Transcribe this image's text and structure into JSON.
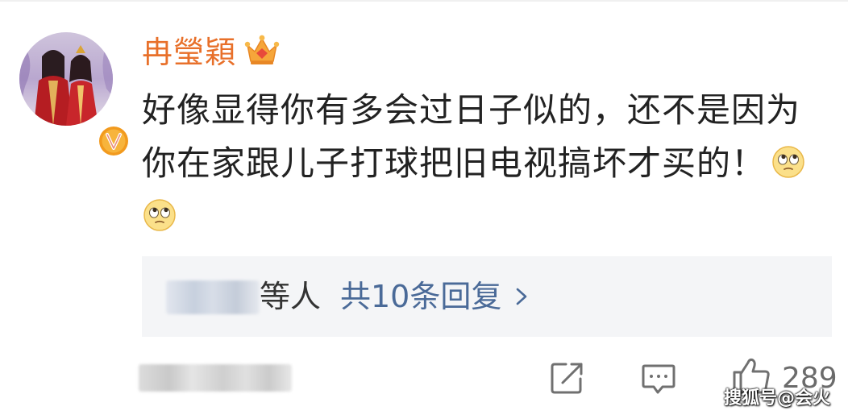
{
  "comment": {
    "username": "冉瑩穎",
    "text_line1": "好像显得你有多会过日子似的，还不是因为",
    "text_line2": "你在家跟儿子打球把旧电视搞坏才买的！",
    "emojis": [
      "eye-roll-emoji",
      "eye-roll-emoji"
    ],
    "badge_icon": "crown-icon",
    "verified_icon": "v-verified-icon"
  },
  "replies": {
    "suffix": "等人",
    "link_label": "共10条回复"
  },
  "actions": {
    "share_icon": "share-icon",
    "comment_icon": "comment-icon",
    "like_icon": "thumbs-up-icon",
    "like_count": "289"
  },
  "watermark": "搜狐号@会火",
  "colors": {
    "username": "#e8702a",
    "link": "#4a6a98",
    "reply_box_bg": "#f4f5f7",
    "verified": "#f29a1e"
  }
}
